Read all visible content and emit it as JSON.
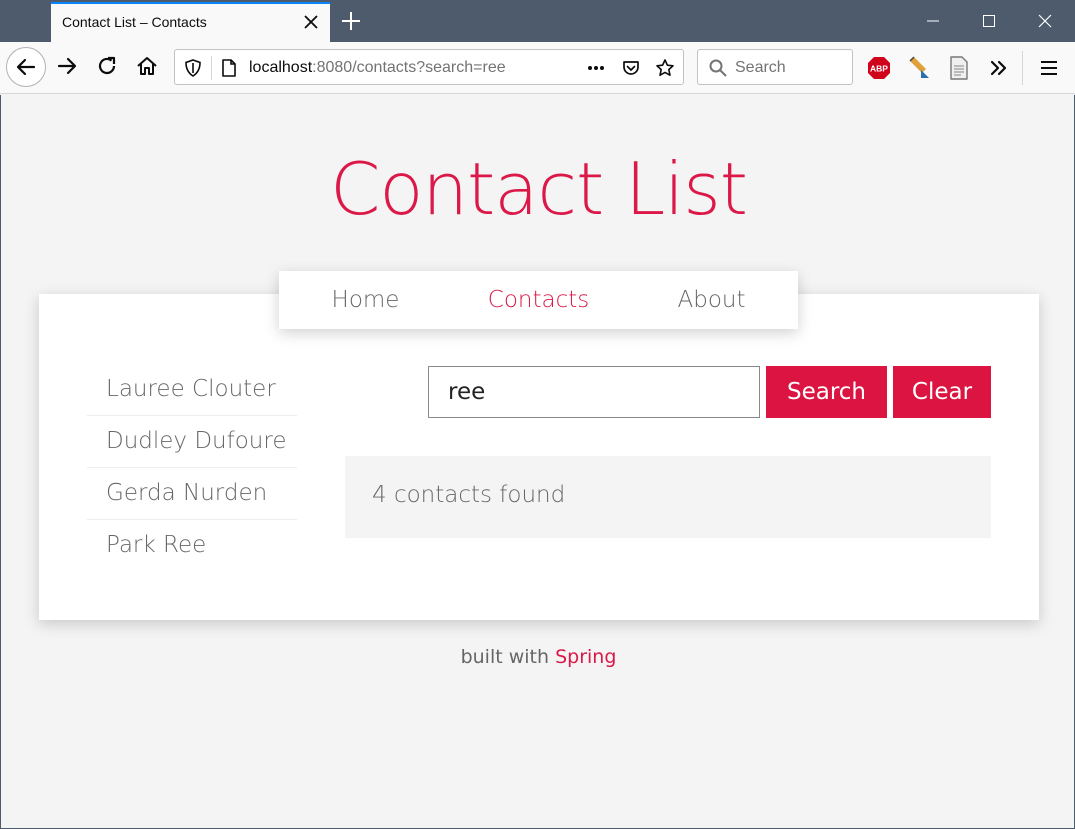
{
  "browser": {
    "tab_title": "Contact List – Contacts",
    "url_host": "localhost",
    "url_rest": ":8080/contacts?search=ree",
    "search_placeholder": "Search",
    "accent": "#0a84ff"
  },
  "page": {
    "title": "Contact List",
    "nav": [
      {
        "label": "Home",
        "active": false
      },
      {
        "label": "Contacts",
        "active": true
      },
      {
        "label": "About",
        "active": false
      }
    ],
    "contacts": [
      "Lauree Clouter",
      "Dudley Dufoure",
      "Gerda Nurden",
      "Park Ree"
    ],
    "search": {
      "value": "ree",
      "search_label": "Search",
      "clear_label": "Clear"
    },
    "results_text": "4 contacts found",
    "footer": {
      "prefix": "built with",
      "link": "Spring"
    },
    "brand_color": "#db1848"
  }
}
